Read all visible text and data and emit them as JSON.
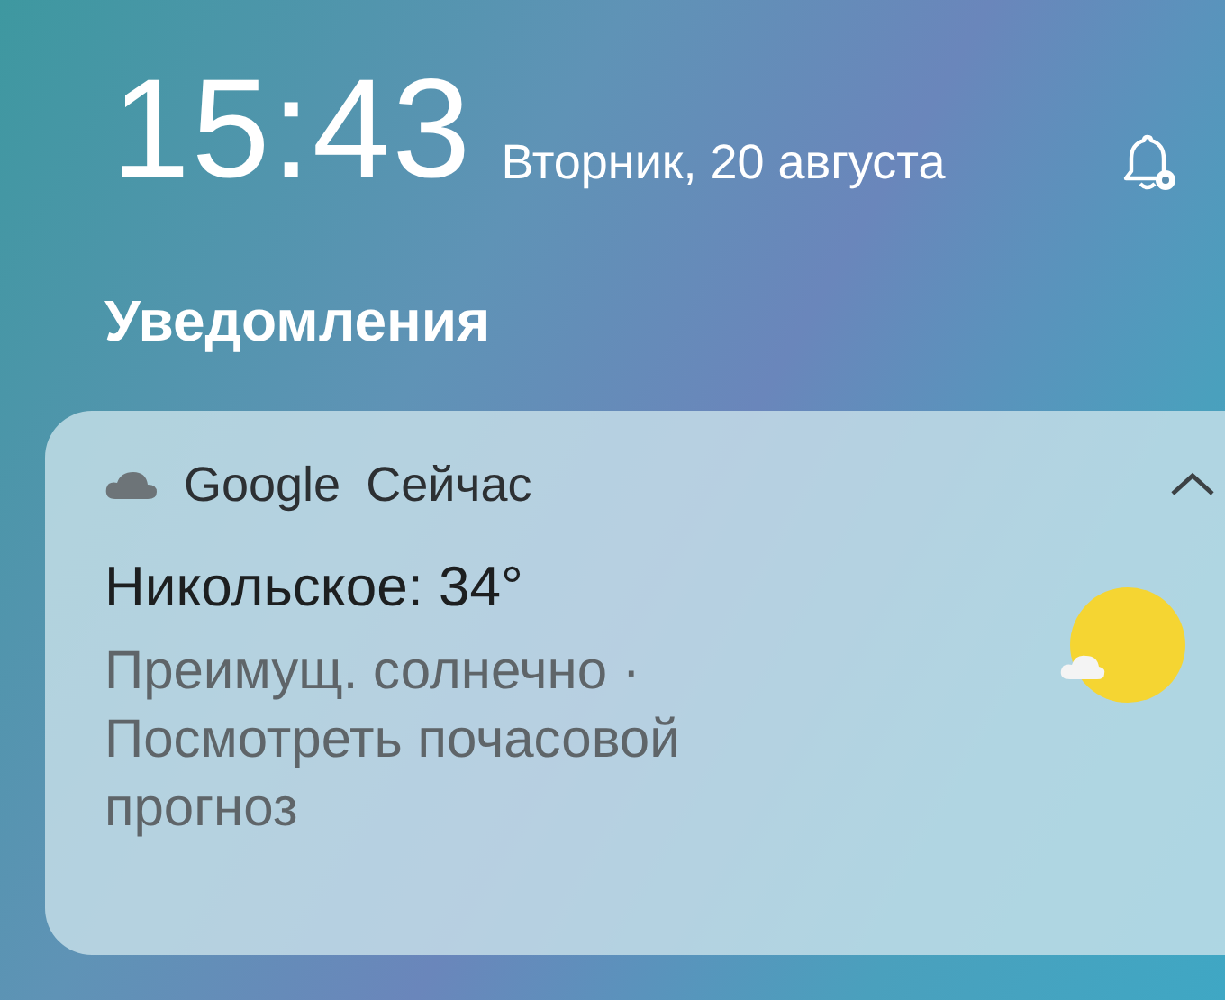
{
  "status": {
    "time": "15:43",
    "date": "Вторник, 20 августа"
  },
  "section_title": "Уведомления",
  "notification": {
    "app": "Google",
    "when": "Сейчас",
    "expanded": true,
    "title": "Никольское: 34°",
    "body": "Преимущ. солнечно · Посмотреть почасовой прогноз"
  }
}
